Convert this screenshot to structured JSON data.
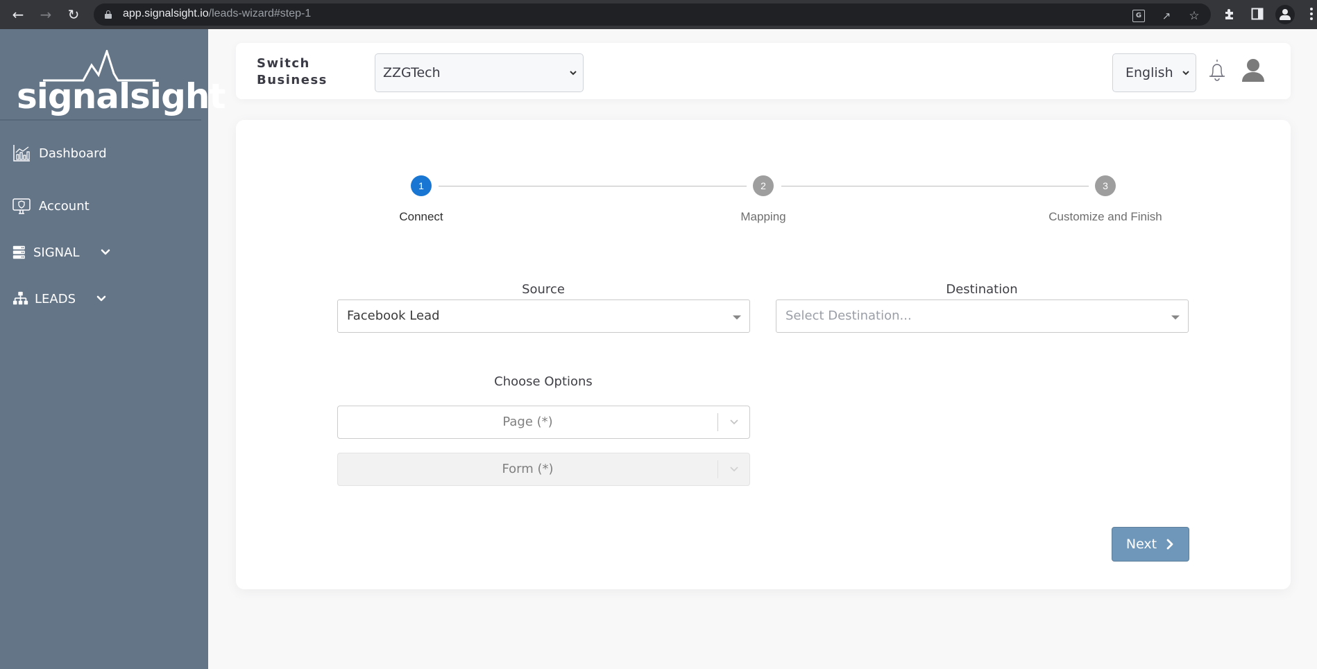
{
  "browser": {
    "url_host": "app.signalsight.io",
    "url_path": "/leads-wizard#step-1",
    "icons": [
      "back-icon",
      "forward-icon",
      "reload-icon",
      "lock-icon",
      "translate-icon",
      "share-icon",
      "star-icon",
      "extensions-icon",
      "side-panel-icon",
      "profile-icon",
      "menu-icon"
    ]
  },
  "sidebar": {
    "logo_text": "signalsight",
    "items": [
      {
        "label": "Dashboard",
        "icon": "chart-icon"
      },
      {
        "label": "Account",
        "icon": "monitor-shield-icon"
      },
      {
        "label": "SIGNAL",
        "icon": "server-icon",
        "expandable": true
      },
      {
        "label": "LEADS",
        "icon": "sitemap-icon",
        "expandable": true
      }
    ]
  },
  "header": {
    "switch_label": "Switch Business",
    "business_selected": "ZZGTech",
    "language_selected": "English"
  },
  "wizard": {
    "current_step": 1,
    "steps": [
      {
        "number": "1",
        "label": "Connect"
      },
      {
        "number": "2",
        "label": "Mapping"
      },
      {
        "number": "3",
        "label": "Customize and Finish"
      }
    ],
    "source": {
      "label": "Source",
      "value": "Facebook Lead"
    },
    "destination": {
      "label": "Destination",
      "placeholder": "Select Destination..."
    },
    "options": {
      "label": "Choose Options",
      "page_placeholder": "Page (*)",
      "form_placeholder": "Form (*)"
    },
    "next_label": "Next"
  },
  "colors": {
    "sidebar": "#647588",
    "active_step": "#1976d2",
    "inactive_step": "#9e9e9e",
    "next_button": "#6f97ba"
  }
}
